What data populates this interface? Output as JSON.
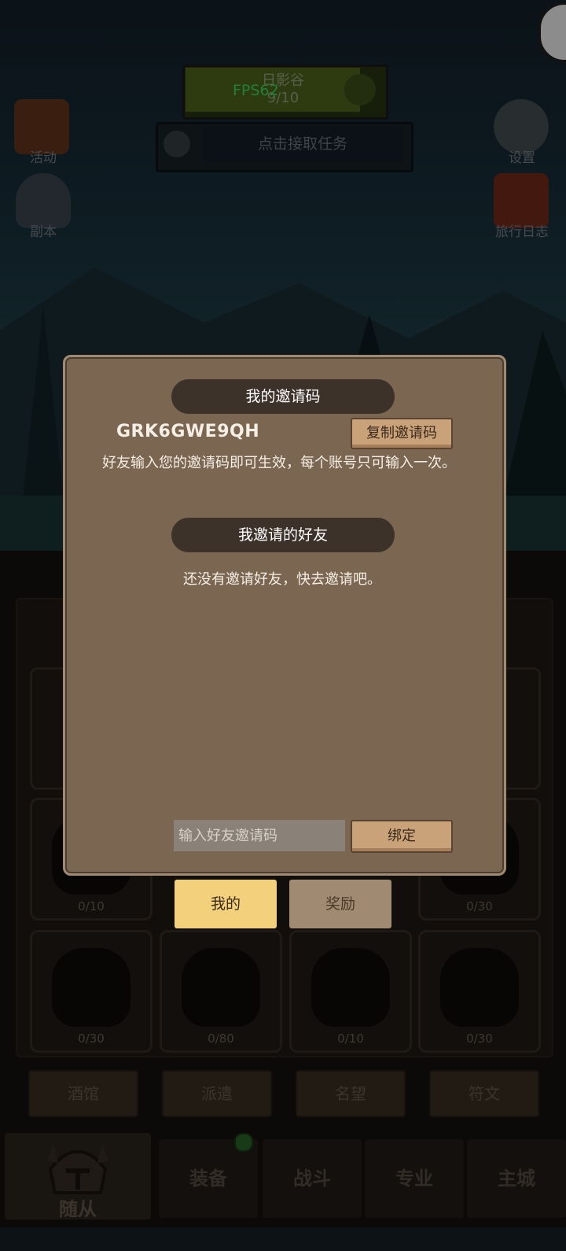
{
  "hud": {
    "fps": "FPS62",
    "quest_title": "日影谷",
    "quest_progress": "9/10",
    "task_prompt": "点击接取任务"
  },
  "side_left": [
    {
      "label": "活动",
      "icon": "activity-board-icon"
    },
    {
      "label": "副本",
      "icon": "dungeon-crest-icon"
    }
  ],
  "side_right": [
    {
      "label": "设置",
      "icon": "gear-icon"
    },
    {
      "label": "旅行日志",
      "icon": "journal-book-icon"
    }
  ],
  "slots": {
    "row3": [
      "0/10",
      "",
      "",
      "0/30"
    ],
    "row4": [
      "0/30",
      "0/80",
      "0/10",
      "0/30"
    ]
  },
  "sub_buttons": [
    "酒馆",
    "派遣",
    "名望",
    "符文"
  ],
  "nav_tabs": [
    "随从",
    "装备",
    "战斗",
    "专业",
    "主城"
  ],
  "dialog": {
    "my_code_title": "我的邀请码",
    "code": "GRK6GWE9QH",
    "copy_button": "复制邀请码",
    "description": "好友输入您的邀请码即可生效，每个账号只可输入一次。",
    "friends_title": "我邀请的好友",
    "empty_message": "还没有邀请好友，快去邀请吧。",
    "input_placeholder": "输入好友邀请码",
    "bind_button": "绑定",
    "tab_mine": "我的",
    "tab_rewards": "奖励"
  },
  "colors": {
    "dialog_bg": "#7a6651",
    "banner_bg": "#3d3229",
    "plank": "#caa27a",
    "tab_active": "#f2d07c",
    "fps_green": "#3fe86a"
  }
}
